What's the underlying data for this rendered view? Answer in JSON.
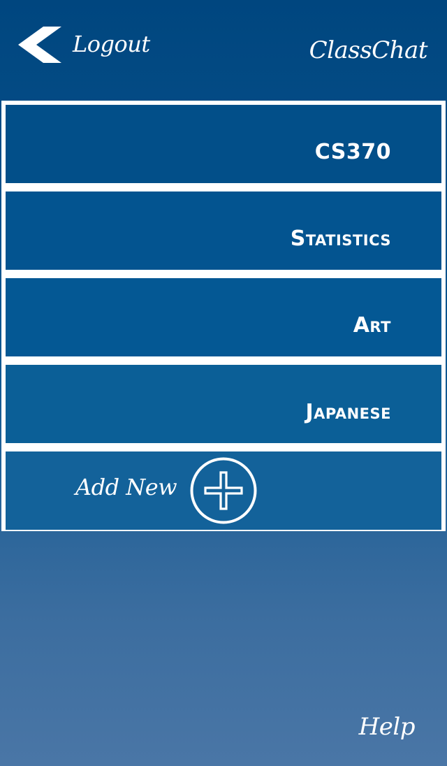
{
  "header": {
    "logout_label": "Logout",
    "app_title": "ClassChat",
    "back_icon": "chevron-left-icon"
  },
  "classes": [
    {
      "label": "CS370",
      "color": "#024f89"
    },
    {
      "label": "Statistics",
      "color": "#035490"
    },
    {
      "label": "Art",
      "color": "#045894"
    },
    {
      "label": "Japanese",
      "color": "#0b5f97"
    }
  ],
  "add_new": {
    "label": "Add New",
    "icon": "plus-circle-icon",
    "color": "#13629a"
  },
  "footer": {
    "help_label": "Help"
  },
  "colors": {
    "background_top": "#00467f",
    "background_bottom": "#4a76a6",
    "text": "#ffffff",
    "frame": "#ffffff"
  }
}
